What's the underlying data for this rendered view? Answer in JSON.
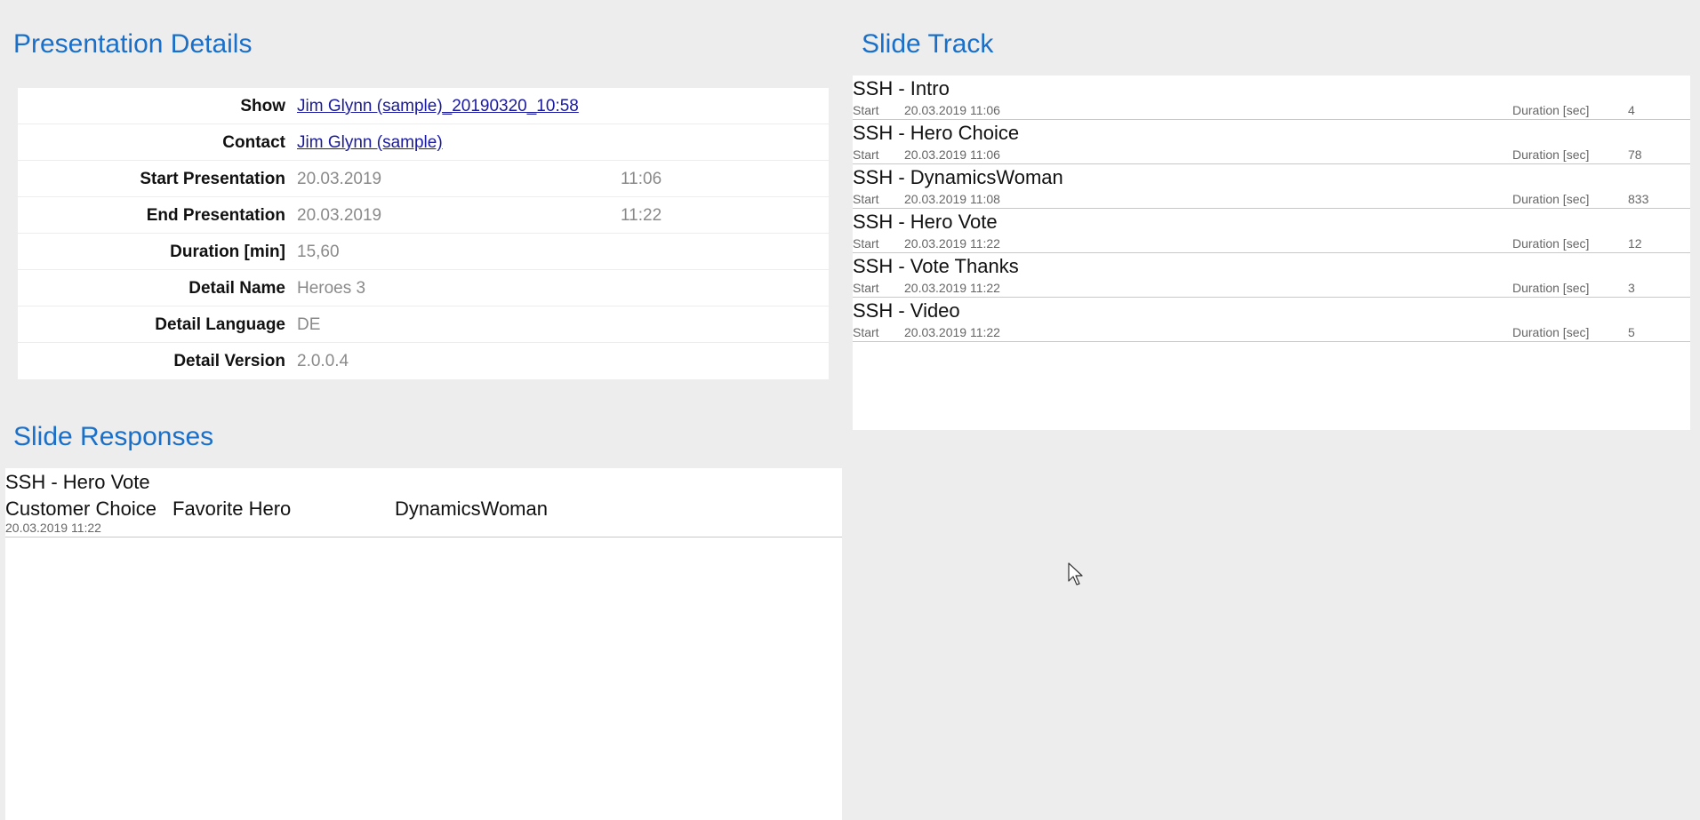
{
  "details": {
    "title": "Presentation Details",
    "rows": [
      {
        "label": "Show",
        "value": "Jim Glynn (sample)_20190320_10:58",
        "link": true,
        "time": ""
      },
      {
        "label": "Contact",
        "value": "Jim Glynn (sample)",
        "link": true,
        "time": ""
      },
      {
        "label": "Start Presentation",
        "value": "20.03.2019",
        "link": false,
        "time": "11:06"
      },
      {
        "label": "End Presentation",
        "value": "20.03.2019",
        "link": false,
        "time": "11:22"
      },
      {
        "label": "Duration [min]",
        "value": "15,60",
        "link": false,
        "time": ""
      },
      {
        "label": "Detail Name",
        "value": "Heroes 3",
        "link": false,
        "time": ""
      },
      {
        "label": "Detail Language",
        "value": "DE",
        "link": false,
        "time": ""
      },
      {
        "label": "Detail Version",
        "value": "2.0.0.4",
        "link": false,
        "time": ""
      }
    ]
  },
  "track": {
    "title": "Slide Track",
    "start_label": "Start",
    "duration_label": "Duration [sec]",
    "items": [
      {
        "name": "SSH - Intro",
        "start": "20.03.2019 11:06",
        "duration": "4"
      },
      {
        "name": "SSH - Hero Choice",
        "start": "20.03.2019 11:06",
        "duration": "78"
      },
      {
        "name": "SSH - DynamicsWoman",
        "start": "20.03.2019 11:08",
        "duration": "833"
      },
      {
        "name": "SSH - Hero Vote",
        "start": "20.03.2019 11:22",
        "duration": "12"
      },
      {
        "name": "SSH - Vote Thanks",
        "start": "20.03.2019 11:22",
        "duration": "3"
      },
      {
        "name": "SSH - Video",
        "start": "20.03.2019 11:22",
        "duration": "5"
      }
    ]
  },
  "responses": {
    "title": "Slide Responses",
    "items": [
      {
        "slide": "SSH - Hero Vote",
        "type": "Customer Choice",
        "question": "Favorite Hero",
        "answer": "DynamicsWoman",
        "date": "20.03.2019 11:22"
      }
    ]
  },
  "cursor": {
    "icon": "mouse-pointer-icon"
  }
}
